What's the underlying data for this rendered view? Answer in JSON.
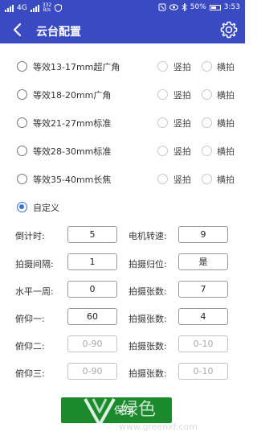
{
  "status": {
    "signal_label": "4G",
    "speed_value": "332",
    "speed_unit": "B/s",
    "battery": "50%",
    "time": "3:53"
  },
  "header": {
    "title": "云台配置"
  },
  "presets": [
    {
      "label": "等效13-17mm超广角"
    },
    {
      "label": "等效18-20mm广角"
    },
    {
      "label": "等效21-27mm标准"
    },
    {
      "label": "等效28-30mm标准"
    },
    {
      "label": "等效35-40mm长焦"
    }
  ],
  "orientation": {
    "portrait": "竖拍",
    "landscape": "横拍"
  },
  "custom": {
    "label": "自定义",
    "selected": true
  },
  "fields": [
    {
      "left_label": "倒计时:",
      "left_value": "5",
      "left_placeholder": "",
      "right_label": "电机转速:",
      "right_value": "9",
      "right_placeholder": ""
    },
    {
      "left_label": "拍摄间隔:",
      "left_value": "1",
      "left_placeholder": "",
      "right_label": "拍摄归位:",
      "right_value": "是",
      "right_placeholder": ""
    },
    {
      "left_label": "水平一周:",
      "left_value": "0",
      "left_placeholder": "",
      "right_label": "拍摄张数:",
      "right_value": "7",
      "right_placeholder": ""
    },
    {
      "left_label": "俯仰一:",
      "left_value": "60",
      "left_placeholder": "",
      "right_label": "拍摄张数:",
      "right_value": "4",
      "right_placeholder": ""
    },
    {
      "left_label": "俯仰二:",
      "left_value": "",
      "left_placeholder": "0-90",
      "right_label": "拍摄张数:",
      "right_value": "",
      "right_placeholder": "0-10"
    },
    {
      "left_label": "俯仰三:",
      "left_value": "",
      "left_placeholder": "0-90",
      "right_label": "拍摄张数:",
      "right_value": "",
      "right_placeholder": "0-10"
    }
  ],
  "actions": {
    "save_label": "保存"
  },
  "watermark": {
    "text": "绿色",
    "sub": "www.greenxf.com"
  },
  "colors": {
    "primary": "#3a4ac2",
    "radio_active": "#3a6fd8",
    "save_button": "#1a8a2c"
  },
  "icons": {
    "back": "chevron-left-icon",
    "settings": "gear-icon"
  }
}
